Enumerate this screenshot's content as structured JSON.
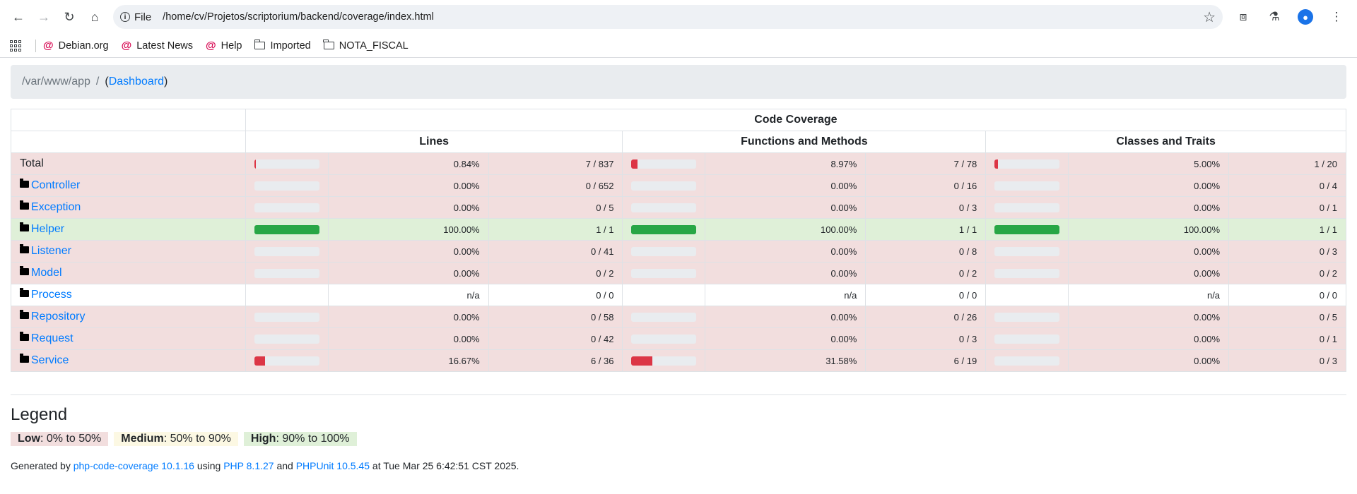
{
  "browser": {
    "chip_label": "File",
    "url": "/home/cv/Projetos/scriptorium/backend/coverage/index.html",
    "bookmarks": [
      {
        "label": "Debian.org",
        "icon": "debian-icon"
      },
      {
        "label": "Latest News",
        "icon": "debian-icon"
      },
      {
        "label": "Help",
        "icon": "debian-icon"
      },
      {
        "label": "Imported",
        "icon": "folder-icon"
      },
      {
        "label": "NOTA_FISCAL",
        "icon": "folder-icon"
      }
    ]
  },
  "breadcrumb": {
    "path": "/var/www/app",
    "separator": "/",
    "open_paren": "(",
    "dashboard_link": "Dashboard",
    "close_paren": ")"
  },
  "table": {
    "header_title": "Code Coverage",
    "columns": [
      "Lines",
      "Functions and Methods",
      "Classes and Traits"
    ],
    "rows": [
      {
        "name": "Total",
        "is_dir": false,
        "level": "danger",
        "lines": {
          "fill": 0.84,
          "percent": "0.84%",
          "ratio": "7 / 837",
          "bar": "low"
        },
        "functions": {
          "fill": 8.97,
          "percent": "8.97%",
          "ratio": "7 / 78",
          "bar": "low"
        },
        "classes": {
          "fill": 5.0,
          "percent": "5.00%",
          "ratio": "1 / 20",
          "bar": "low"
        }
      },
      {
        "name": "Controller",
        "is_dir": true,
        "level": "danger",
        "lines": {
          "fill": 0,
          "percent": "0.00%",
          "ratio": "0 / 652",
          "bar": "low"
        },
        "functions": {
          "fill": 0,
          "percent": "0.00%",
          "ratio": "0 / 16",
          "bar": "low"
        },
        "classes": {
          "fill": 0,
          "percent": "0.00%",
          "ratio": "0 / 4",
          "bar": "low"
        }
      },
      {
        "name": "Exception",
        "is_dir": true,
        "level": "danger",
        "lines": {
          "fill": 0,
          "percent": "0.00%",
          "ratio": "0 / 5",
          "bar": "low"
        },
        "functions": {
          "fill": 0,
          "percent": "0.00%",
          "ratio": "0 / 3",
          "bar": "low"
        },
        "classes": {
          "fill": 0,
          "percent": "0.00%",
          "ratio": "0 / 1",
          "bar": "low"
        }
      },
      {
        "name": "Helper",
        "is_dir": true,
        "level": "success",
        "lines": {
          "fill": 100,
          "percent": "100.00%",
          "ratio": "1 / 1",
          "bar": "high"
        },
        "functions": {
          "fill": 100,
          "percent": "100.00%",
          "ratio": "1 / 1",
          "bar": "high"
        },
        "classes": {
          "fill": 100,
          "percent": "100.00%",
          "ratio": "1 / 1",
          "bar": "high"
        }
      },
      {
        "name": "Listener",
        "is_dir": true,
        "level": "danger",
        "lines": {
          "fill": 0,
          "percent": "0.00%",
          "ratio": "0 / 41",
          "bar": "low"
        },
        "functions": {
          "fill": 0,
          "percent": "0.00%",
          "ratio": "0 / 8",
          "bar": "low"
        },
        "classes": {
          "fill": 0,
          "percent": "0.00%",
          "ratio": "0 / 3",
          "bar": "low"
        }
      },
      {
        "name": "Model",
        "is_dir": true,
        "level": "danger",
        "lines": {
          "fill": 0,
          "percent": "0.00%",
          "ratio": "0 / 2",
          "bar": "low"
        },
        "functions": {
          "fill": 0,
          "percent": "0.00%",
          "ratio": "0 / 2",
          "bar": "low"
        },
        "classes": {
          "fill": 0,
          "percent": "0.00%",
          "ratio": "0 / 2",
          "bar": "low"
        }
      },
      {
        "name": "Process",
        "is_dir": true,
        "level": "none",
        "lines": {
          "fill": null,
          "percent": "n/a",
          "ratio": "0 / 0",
          "bar": "none"
        },
        "functions": {
          "fill": null,
          "percent": "n/a",
          "ratio": "0 / 0",
          "bar": "none"
        },
        "classes": {
          "fill": null,
          "percent": "n/a",
          "ratio": "0 / 0",
          "bar": "none"
        }
      },
      {
        "name": "Repository",
        "is_dir": true,
        "level": "danger",
        "lines": {
          "fill": 0,
          "percent": "0.00%",
          "ratio": "0 / 58",
          "bar": "low"
        },
        "functions": {
          "fill": 0,
          "percent": "0.00%",
          "ratio": "0 / 26",
          "bar": "low"
        },
        "classes": {
          "fill": 0,
          "percent": "0.00%",
          "ratio": "0 / 5",
          "bar": "low"
        }
      },
      {
        "name": "Request",
        "is_dir": true,
        "level": "danger",
        "lines": {
          "fill": 0,
          "percent": "0.00%",
          "ratio": "0 / 42",
          "bar": "low"
        },
        "functions": {
          "fill": 0,
          "percent": "0.00%",
          "ratio": "0 / 3",
          "bar": "low"
        },
        "classes": {
          "fill": 0,
          "percent": "0.00%",
          "ratio": "0 / 1",
          "bar": "low"
        }
      },
      {
        "name": "Service",
        "is_dir": true,
        "level": "danger",
        "lines": {
          "fill": 16.67,
          "percent": "16.67%",
          "ratio": "6 / 36",
          "bar": "low"
        },
        "functions": {
          "fill": 31.58,
          "percent": "31.58%",
          "ratio": "6 / 19",
          "bar": "low"
        },
        "classes": {
          "fill": 0,
          "percent": "0.00%",
          "ratio": "0 / 3",
          "bar": "low"
        }
      }
    ]
  },
  "legend": {
    "title": "Legend",
    "low_label": "Low",
    "low_range": ": 0% to 50%",
    "medium_label": "Medium",
    "medium_range": ": 50% to 90%",
    "high_label": "High",
    "high_range": ": 90% to 100%"
  },
  "footer": {
    "prefix": "Generated by ",
    "generator_link": "php-code-coverage 10.1.16",
    "using": " using ",
    "php_link": "PHP 8.1.27",
    "and": " and ",
    "phpunit_link": "PHPUnit 10.5.45",
    "suffix": " at Tue Mar 25 6:42:51 CST 2025."
  },
  "colors": {
    "danger_row": "#f2dede",
    "success_row": "#dff0d8",
    "bar_low": "#dc3545",
    "bar_high": "#28a745",
    "link": "#007bff"
  }
}
